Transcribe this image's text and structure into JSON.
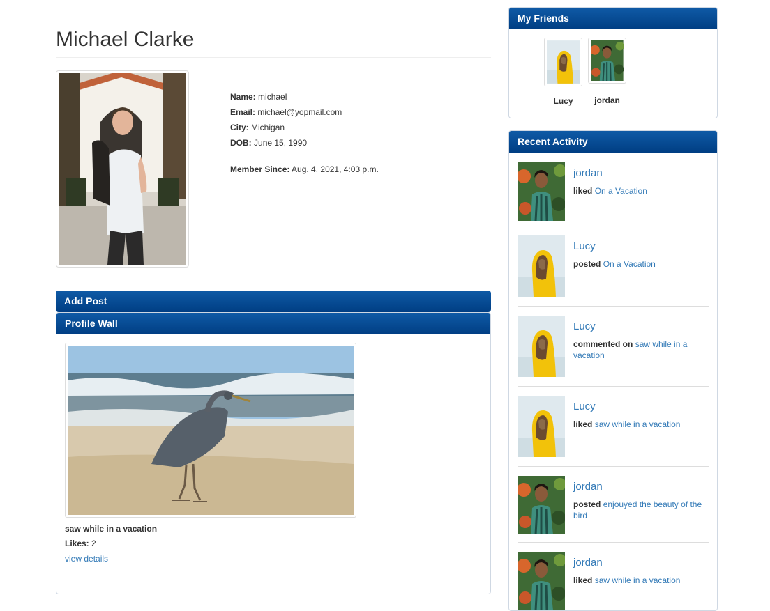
{
  "profile": {
    "name": "Michael Clarke",
    "fields": [
      {
        "label": "Name:",
        "value": "michael"
      },
      {
        "label": "Email:",
        "value": "michael@yopmail.com"
      },
      {
        "label": "City:",
        "value": "Michigan"
      },
      {
        "label": "DOB:",
        "value": "June 15, 1990"
      }
    ],
    "member_since_label": "Member Since:",
    "member_since_value": "Aug. 4, 2021, 4:03 p.m."
  },
  "add_post": {
    "title": "Add Post"
  },
  "wall": {
    "title": "Profile Wall",
    "post": {
      "title": "saw while in a vacation",
      "likes_label": "Likes:",
      "likes_value": "2",
      "link": "view details"
    }
  },
  "friends": {
    "title": "My Friends",
    "items": [
      {
        "name": "Lucy"
      },
      {
        "name": "jordan"
      }
    ]
  },
  "activity": {
    "title": "Recent Activity",
    "items": [
      {
        "user": "jordan",
        "action": "liked",
        "target": "On a Vacation"
      },
      {
        "user": "Lucy",
        "action": "posted",
        "target": "On a Vacation"
      },
      {
        "user": "Lucy",
        "action": "commented on",
        "target": "saw while in a vacation"
      },
      {
        "user": "Lucy",
        "action": "liked",
        "target": "saw while in a vacation"
      },
      {
        "user": "jordan",
        "action": "posted",
        "target": "enjouyed the beauty of the bird"
      },
      {
        "user": "jordan",
        "action": "liked",
        "target": "saw while in a vacation"
      }
    ]
  },
  "colors": {
    "panel_header": "#003e83",
    "link": "#337ab7",
    "text": "#333333"
  }
}
